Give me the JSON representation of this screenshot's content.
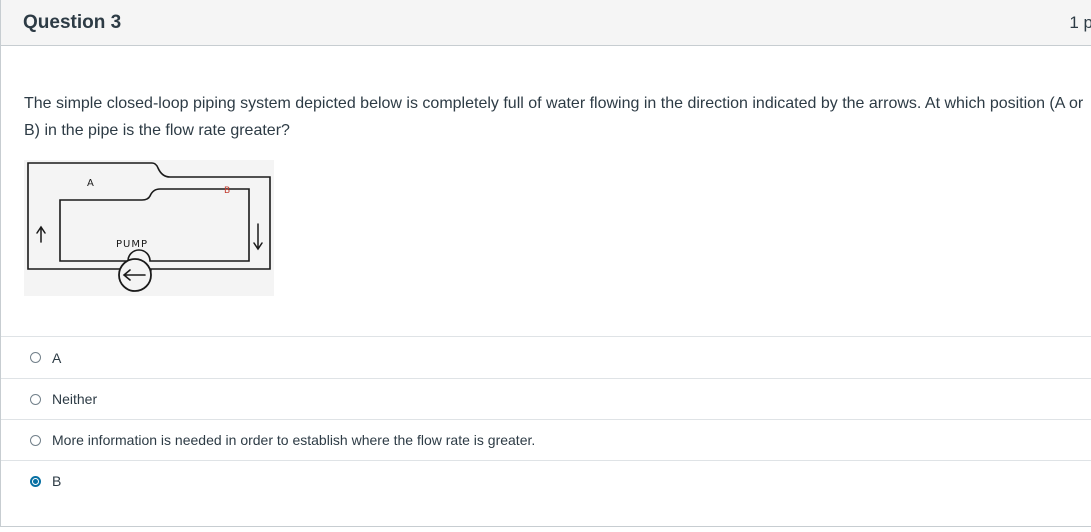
{
  "question": {
    "title": "Question 3",
    "points": "1 p",
    "text": "The simple closed-loop piping system depicted below is completely full of water flowing in the direction indicated by the arrows. At which position (A or B) in the pipe is the flow rate greater?"
  },
  "figure": {
    "label_a": "A",
    "label_b": "B",
    "label_pump": "PUMP"
  },
  "answers": [
    {
      "label": "A",
      "selected": false
    },
    {
      "label": "Neither",
      "selected": false
    },
    {
      "label": "More information is needed in order to establish where the flow rate is greater.",
      "selected": false
    },
    {
      "label": "B",
      "selected": true
    }
  ],
  "colors": {
    "selected_radio": "#0770a3",
    "label_b": "#c0392b",
    "text": "#2d3b45"
  }
}
